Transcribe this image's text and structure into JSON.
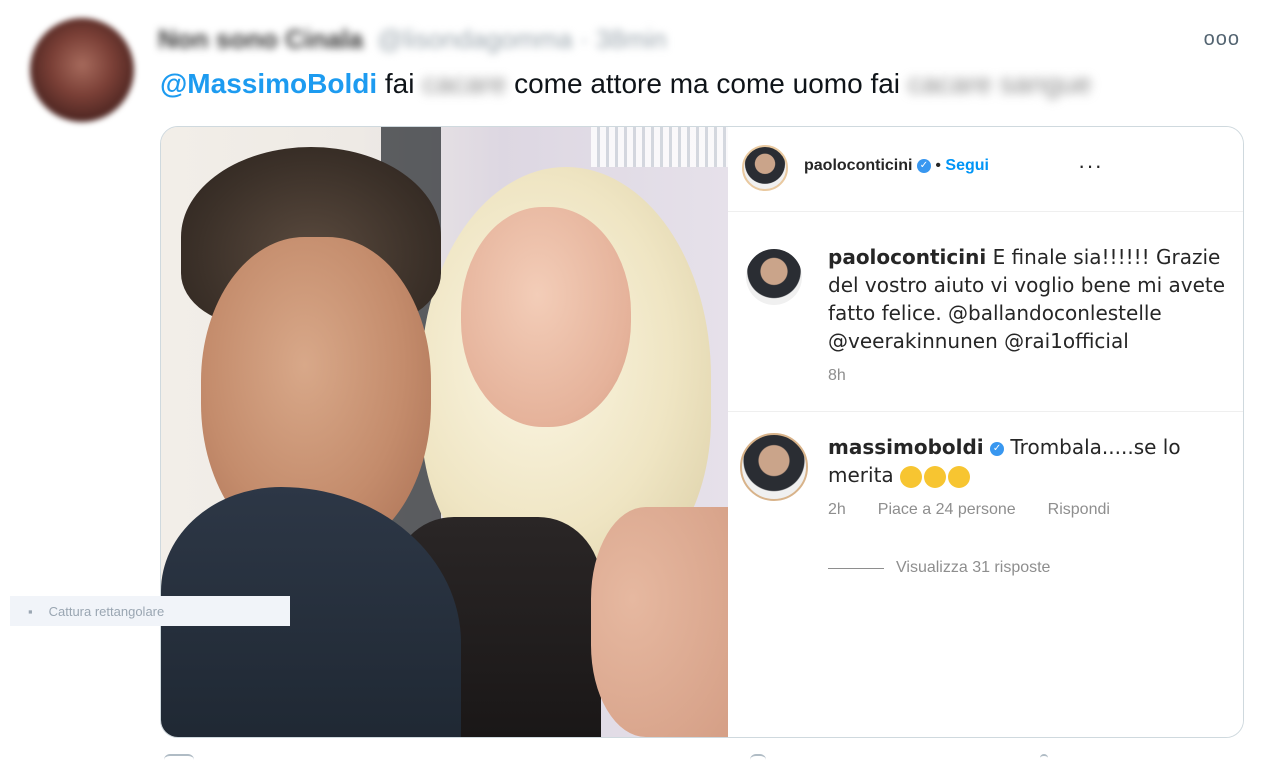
{
  "tweet": {
    "author_name": "Non sono Cinala",
    "author_handle": "@lisondagomma · 38min",
    "more_icon": "more-dots-icon",
    "text": {
      "mention": "@MassimoBoldi",
      "part1": "fai",
      "blur1": "cacare",
      "part2": "come attore ma come uomo fai",
      "blur2": "cacare sangue"
    }
  },
  "instagram": {
    "username": "paoloconticini",
    "follow": "Segui",
    "more": "···",
    "caption_user": "paoloconticini",
    "caption_text": "E finale sia!!!!!! Grazie del vostro aiuto vi voglio bene mi avete fatto felice. @ballandoconlestelle @veerakinnunen @rai1official",
    "caption_time": "8h",
    "comment_user": "massimoboldi",
    "comment_text": "Trombala.....se lo merita",
    "comment_time": "2h",
    "comment_likes": "Piace a 24 persone",
    "comment_reply": "Rispondi",
    "view_replies": "Visualizza 31 risposte"
  },
  "overlay": {
    "ghost_label": "Cattura rettangolare"
  },
  "colors": {
    "mention": "#1d9bf0",
    "ig_link": "#0095f6",
    "border": "#cfd9de"
  }
}
